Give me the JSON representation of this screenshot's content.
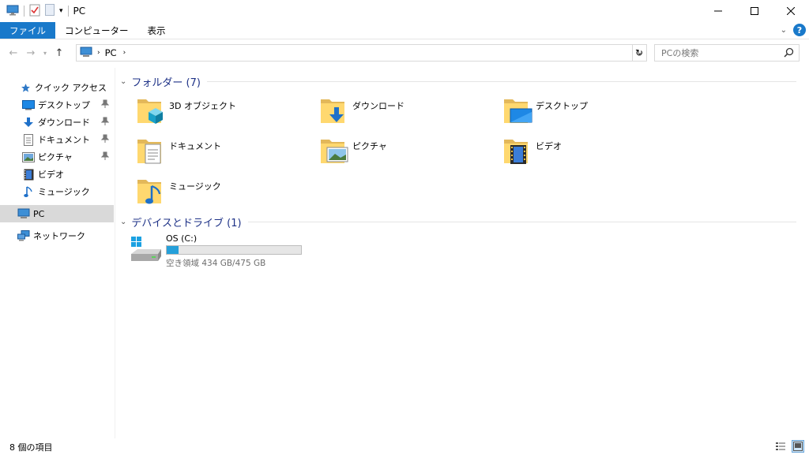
{
  "window": {
    "title": "PC"
  },
  "ribbon": {
    "tabs": [
      "ファイル",
      "コンピューター",
      "表示"
    ]
  },
  "address": {
    "crumb": "PC",
    "search_placeholder": "PCの検索"
  },
  "sidebar": {
    "quick_access": "クイック アクセス",
    "quick_items": [
      {
        "label": "デスクトップ",
        "icon": "desktop-icon",
        "pinned": true
      },
      {
        "label": "ダウンロード",
        "icon": "download-arrow-icon",
        "pinned": true
      },
      {
        "label": "ドキュメント",
        "icon": "document-icon",
        "pinned": true
      },
      {
        "label": "ピクチャ",
        "icon": "picture-icon",
        "pinned": true
      },
      {
        "label": "ビデオ",
        "icon": "video-icon",
        "pinned": false
      },
      {
        "label": "ミュージック",
        "icon": "music-icon",
        "pinned": false
      }
    ],
    "pc": "PC",
    "network": "ネットワーク"
  },
  "main": {
    "folders_header": "フォルダー (7)",
    "folders": [
      {
        "label": "3D オブジェクト",
        "icon": "3d-objects-folder-icon"
      },
      {
        "label": "ダウンロード",
        "icon": "downloads-folder-icon"
      },
      {
        "label": "デスクトップ",
        "icon": "desktop-folder-icon"
      },
      {
        "label": "ドキュメント",
        "icon": "documents-folder-icon"
      },
      {
        "label": "ピクチャ",
        "icon": "pictures-folder-icon"
      },
      {
        "label": "ビデオ",
        "icon": "videos-folder-icon"
      },
      {
        "label": "ミュージック",
        "icon": "music-folder-icon"
      }
    ],
    "devices_header": "デバイスとドライブ (1)",
    "drive": {
      "name": "OS (C:)",
      "free_text": "空き領域 434 GB/475 GB",
      "used_fraction": 0.086,
      "bar_color": "#26a0da"
    }
  },
  "status": {
    "count": "8 個の項目"
  },
  "colors": {
    "accent": "#1979ca",
    "header_text": "#1e3287",
    "selection": "#d9d9d9"
  }
}
